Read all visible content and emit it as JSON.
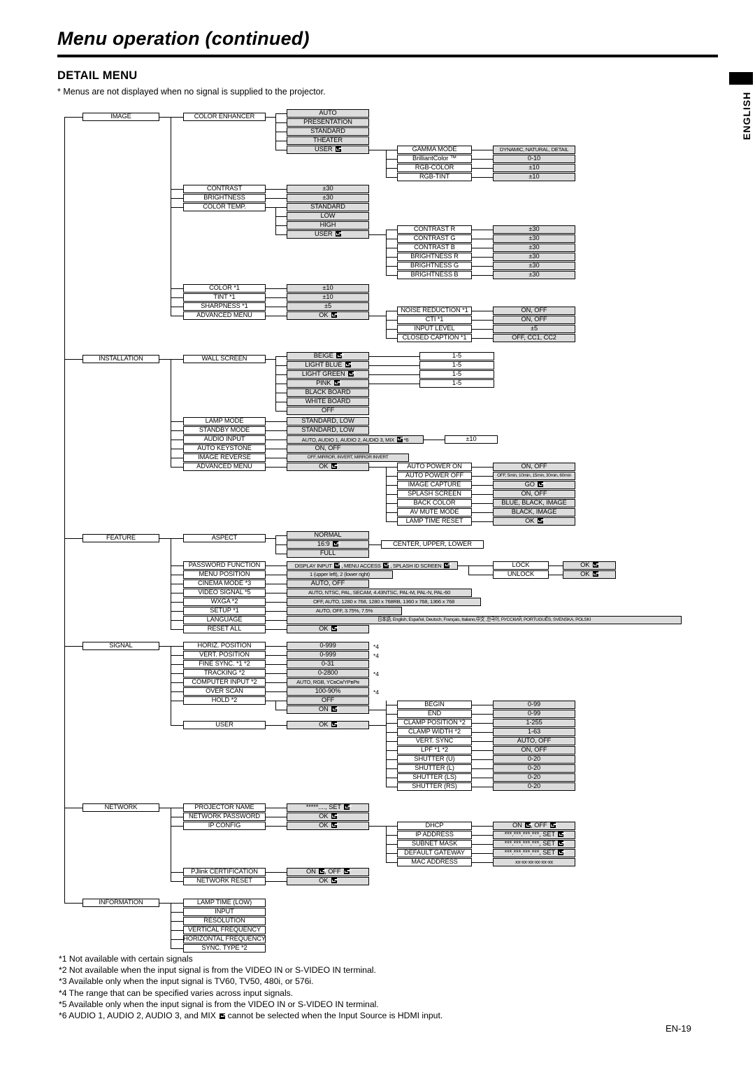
{
  "header": {
    "title": "Menu operation (continued)",
    "section_title": "DETAIL MENU",
    "section_note": "* Menus are not displayed when no signal is supplied to the projector."
  },
  "side_tab": {
    "label": "ENGLISH"
  },
  "page_number": "EN-19",
  "footnotes": [
    "*1 Not available with certain signals",
    "*2 Not available when the input signal is from the VIDEO IN or S-VIDEO IN terminal.",
    "*3 Available only when the input signal is TV60, TV50, 480i, or 576i.",
    "*4 The range that can be specified varies across input signals.",
    "*5 Available only when the input signal is from the VIDEO IN or S-VIDEO IN terminal.",
    "*6 AUDIO 1, AUDIO 2, AUDIO 3, and MIX ↲ cannot be selected when the Input Source is HDMI input."
  ],
  "diagram": {
    "roots": [
      "IMAGE",
      "INSTALLATION",
      "FEATURE",
      "SIGNAL",
      "NETWORK",
      "INFORMATION"
    ],
    "image": {
      "label": "IMAGE",
      "items": [
        "COLOR ENHANCER",
        "CONTRAST",
        "BRIGHTNESS",
        "COLOR TEMP.",
        "COLOR *1",
        "TINT *1",
        "SHARPNESS *1",
        "ADVANCED MENU"
      ],
      "color_enhancer_values": [
        "AUTO",
        "PRESENTATION",
        "STANDARD",
        "THEATER",
        "USER ↲"
      ],
      "user_submenu": [
        "GAMMA MODE",
        "BrilliantColor ™",
        "RGB-COLOR",
        "RGB-TINT"
      ],
      "user_submenu_values": [
        "DYNAMIC, NATURAL, DETAIL",
        "0-10",
        "±10",
        "±10"
      ],
      "contrast_value": "±30",
      "brightness_value": "±30",
      "color_temp_values": [
        "STANDARD",
        "LOW",
        "HIGH",
        "USER ↲"
      ],
      "color_temp_user_submenu": [
        "CONTRAST R",
        "CONTRAST G",
        "CONTRAST B",
        "BRIGHTNESS R",
        "BRIGHTNESS G",
        "BRIGHTNESS B"
      ],
      "color_temp_user_values": [
        "±30",
        "±30",
        "±30",
        "±30",
        "±30",
        "±30"
      ],
      "color_value": "±10",
      "tint_value": "±10",
      "sharpness_value": "±5",
      "advanced_menu_value": "OK ↲",
      "advanced_submenu": [
        "NOISE REDUCTION *1",
        "CTI *1",
        "INPUT LEVEL",
        "CLOSED CAPTION *1"
      ],
      "advanced_submenu_values": [
        "ON, OFF",
        "ON, OFF",
        "±5",
        "OFF, CC1, CC2"
      ]
    },
    "installation": {
      "label": "INSTALLATION",
      "items": [
        "WALL SCREEN",
        "LAMP MODE",
        "STANDBY MODE",
        "AUDIO INPUT",
        "AUTO KEYSTONE",
        "IMAGE REVERSE",
        "ADVANCED MENU"
      ],
      "wall_screen_values": [
        "BEIGE ↲",
        "LIGHT BLUE ↲",
        "LIGHT GREEN ↲",
        "PINK ↲",
        "BLACK BOARD",
        "WHITE BOARD",
        "OFF"
      ],
      "wall_screen_levels": [
        "1-5",
        "1-5",
        "1-5",
        "1-5"
      ],
      "lamp_mode_value": "STANDARD, LOW",
      "standby_mode_value": "STANDARD, LOW",
      "audio_input_value": "AUTO, AUDIO 1, AUDIO 2, AUDIO 3, MIX ↲ *6",
      "audio_input_sub": "±10",
      "auto_keystone_value": "ON, OFF",
      "image_reverse_value": "OFF, MIRROR, INVERT, MIRROR INVERT",
      "advanced_menu_value": "OK ↲",
      "advanced_submenu": [
        "AUTO POWER ON",
        "AUTO POWER OFF",
        "IMAGE CAPTURE",
        "SPLASH SCREEN",
        "BACK COLOR",
        "AV MUTE MODE",
        "LAMP TIME RESET"
      ],
      "advanced_submenu_values": [
        "ON, OFF",
        "OFF, 5min, 10min, 15min, 30min, 60min",
        "GO ↲",
        "ON, OFF",
        "BLUE, BLACK, IMAGE",
        "BLACK, IMAGE",
        "OK ↲"
      ]
    },
    "feature": {
      "label": "FEATURE",
      "items": [
        "ASPECT",
        "PASSWORD FUNCTION",
        "MENU POSITION",
        "CINEMA MODE *3",
        "VIDEO SIGNAL *5",
        "WXGA *2",
        "SETUP *1",
        "LANGUAGE",
        "RESET ALL"
      ],
      "aspect_values": [
        "NORMAL",
        "16:9 ↲",
        "FULL"
      ],
      "aspect_169_sub": "CENTER, UPPER, LOWER",
      "password_function_value": "DISPLAY INPUT ↲ , MENU ACCESS ↲ , SPLASH ID SCREEN ↲",
      "password_lock_items": [
        "LOCK",
        "UNLOCK"
      ],
      "password_lock_values": [
        "OK ↲",
        "OK ↲"
      ],
      "menu_position_value": "1 (upper left),  2 (lower right)",
      "cinema_mode_value": "AUTO, OFF",
      "video_signal_value": "AUTO, NTSC, PAL, SECAM, 4.43NTSC, PAL-M, PAL-N, PAL-60",
      "wxga_value": "OFF, AUTO, 1280 x 768, 1280 x 768RB, 1360 x 768, 1366 x 768",
      "setup_value": "AUTO, OFF, 3.75%, 7.5%",
      "language_value": "日本語, English, Español, Deutsch, Français, Italiano,中文 ,한국어, РУССКИЙ, PORTUGUÊS, SVENSKA, POLSKI",
      "reset_all_value": "OK ↲"
    },
    "signal": {
      "label": "SIGNAL",
      "items": [
        "HORIZ. POSITION",
        "VERT. POSITION",
        "FINE SYNC. *1 *2",
        "TRACKING *2",
        "COMPUTER INPUT *2",
        "OVER SCAN",
        "HOLD *2",
        "USER"
      ],
      "values": [
        "0-999",
        "0-999",
        "0-31",
        "0-2800",
        "AUTO, RGB, YCʙCʀ/YPʙPʀ",
        "100-90%",
        "OFF",
        "OK ↲"
      ],
      "hold_on_value": "ON ↲",
      "marks": [
        "*4",
        "*4",
        "",
        "*4",
        "",
        "*4",
        "",
        ""
      ],
      "user_submenu": [
        "BEGIN",
        "END",
        "CLAMP POSITION *2",
        "CLAMP WIDTH *2",
        "VERT. SYNC",
        "LPF *1 *2",
        "SHUTTER (U)",
        "SHUTTER (L)",
        "SHUTTER (LS)",
        "SHUTTER (RS)"
      ],
      "user_submenu_values": [
        "0-99",
        "0-99",
        "1-255",
        "1-63",
        "AUTO, OFF",
        "ON, OFF",
        "0-20",
        "0-20",
        "0-20",
        "0-20"
      ]
    },
    "network": {
      "label": "NETWORK",
      "items": [
        "PROJECTOR NAME",
        "NETWORK PASSWORD",
        "IP CONFIG",
        "PJlink CERTIFICATION",
        "NETWORK RESET"
      ],
      "values": [
        "*****...., SET ↲",
        "OK ↲",
        "OK ↲",
        "ON ↲, OFF ↲",
        "OK ↲"
      ],
      "ip_config_submenu": [
        "DHCP",
        "IP ADDRESS",
        "SUBNET MASK",
        "DEFAULT GATEWAY",
        "MAC ADDRESS"
      ],
      "ip_config_values": [
        "ON ↲, OFF ↲",
        "***.***.***.***, SET ↲",
        "***.***.***.***, SET ↲",
        "***.***.***.***, SET ↲",
        "xx-xx-xx-xx-xx-xx"
      ]
    },
    "information": {
      "label": "INFORMATION",
      "items": [
        "LAMP TIME (LOW)",
        "INPUT",
        "RESOLUTION",
        "VERTICAL FREQUENCY",
        "HORIZONTAL FREQUENCY",
        "SYNC. TYPE *2"
      ]
    }
  }
}
